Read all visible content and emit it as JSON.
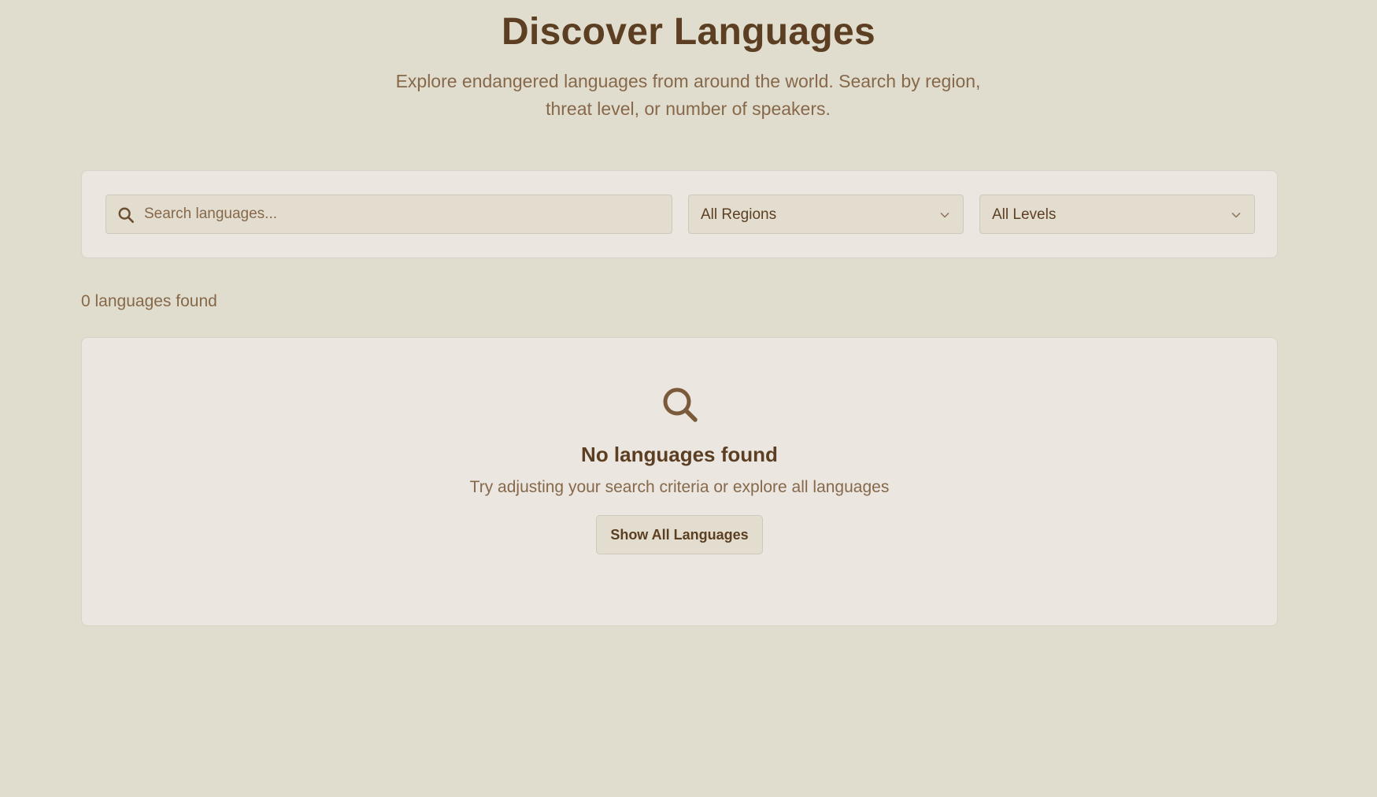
{
  "header": {
    "title": "Discover Languages",
    "subtitle": "Explore endangered languages from around the world. Search by region, threat level, or number of speakers."
  },
  "filters": {
    "search": {
      "placeholder": "Search languages...",
      "value": "",
      "icon": "search-icon"
    },
    "region": {
      "selected": "All Regions",
      "icon": "chevron-down-icon"
    },
    "level": {
      "selected": "All Levels",
      "icon": "chevron-down-icon"
    }
  },
  "results": {
    "count_text": "0 languages found"
  },
  "empty_state": {
    "icon": "search-icon",
    "title": "No languages found",
    "description": "Try adjusting your search criteria or explore all languages",
    "button_label": "Show All Languages"
  },
  "colors": {
    "background": "#e1ddce",
    "card": "#ebe6e0",
    "primary_text": "#5c3f22",
    "secondary_text": "#86684a"
  }
}
